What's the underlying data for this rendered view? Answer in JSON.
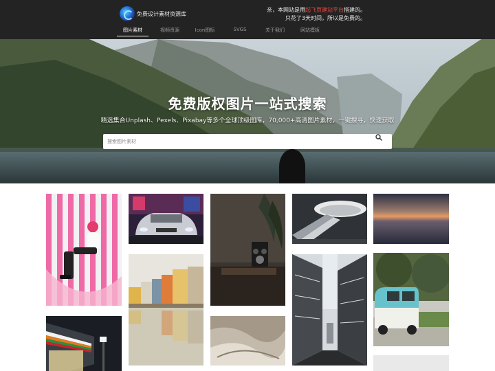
{
  "header": {
    "logo_text": "免费设计素材资源库",
    "notice_prefix": "亲，本网站是用",
    "notice_highlight": "起飞页建站平台",
    "notice_suffix": "搭建的。",
    "notice_line2": "只花了3天时间，所以是免费的。"
  },
  "nav": {
    "items": [
      {
        "label": "图片素材",
        "active": true
      },
      {
        "label": "视频资源",
        "active": false
      },
      {
        "label": "Icon图标",
        "active": false
      },
      {
        "label": "SVGS",
        "active": false
      },
      {
        "label": "关于我们",
        "active": false
      },
      {
        "label": "网站模板",
        "active": false
      }
    ]
  },
  "hero": {
    "title": "免费版权图片一站式搜索",
    "subtitle": "精选集合Unplash、Pexels、Pixabay等多个全球顶级图库，70,000+高清图片素材，一键搜寻，快速获取",
    "search_placeholder": "搜索图片素材"
  },
  "icons": {
    "search": "search-icon",
    "logo": "logo-icon"
  },
  "colors": {
    "topbar": "#232323",
    "highlight": "#e8473f"
  },
  "gallery": {
    "items": [
      {
        "name": "photo-pink-stripes"
      },
      {
        "name": "photo-silver-car"
      },
      {
        "name": "photo-vintage-camera"
      },
      {
        "name": "photo-escalator"
      },
      {
        "name": "photo-dusk-sky"
      },
      {
        "name": "photo-canal-houses"
      },
      {
        "name": "photo-timber-street"
      },
      {
        "name": "photo-vw-bus"
      },
      {
        "name": "photo-convenience-store"
      },
      {
        "name": "photo-sand-texture"
      },
      {
        "name": "photo-light-grey"
      }
    ]
  }
}
